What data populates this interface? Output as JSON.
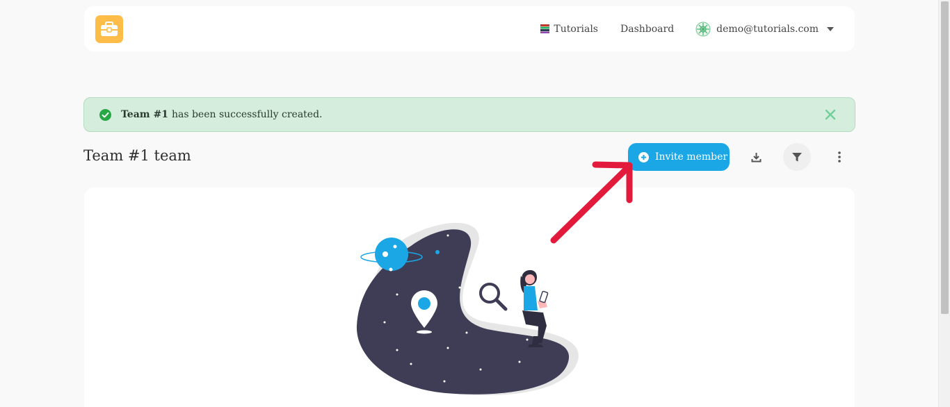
{
  "header": {
    "logo_icon": "toolbox-icon",
    "nav": {
      "tutorials": "Tutorials",
      "dashboard": "Dashboard",
      "user_email": "demo@tutorials.com"
    }
  },
  "alert": {
    "strong": "Team #1",
    "message": "has been successfully created.",
    "color": "#d5eddc"
  },
  "page": {
    "title": "Team #1 team",
    "invite_label": "Invite member",
    "accent": "#1ba7e6"
  },
  "icons": {
    "download": "download-icon",
    "filter": "filter-icon",
    "more": "more-vertical-icon"
  },
  "annotation": {
    "arrow_color": "#e21b3c"
  }
}
